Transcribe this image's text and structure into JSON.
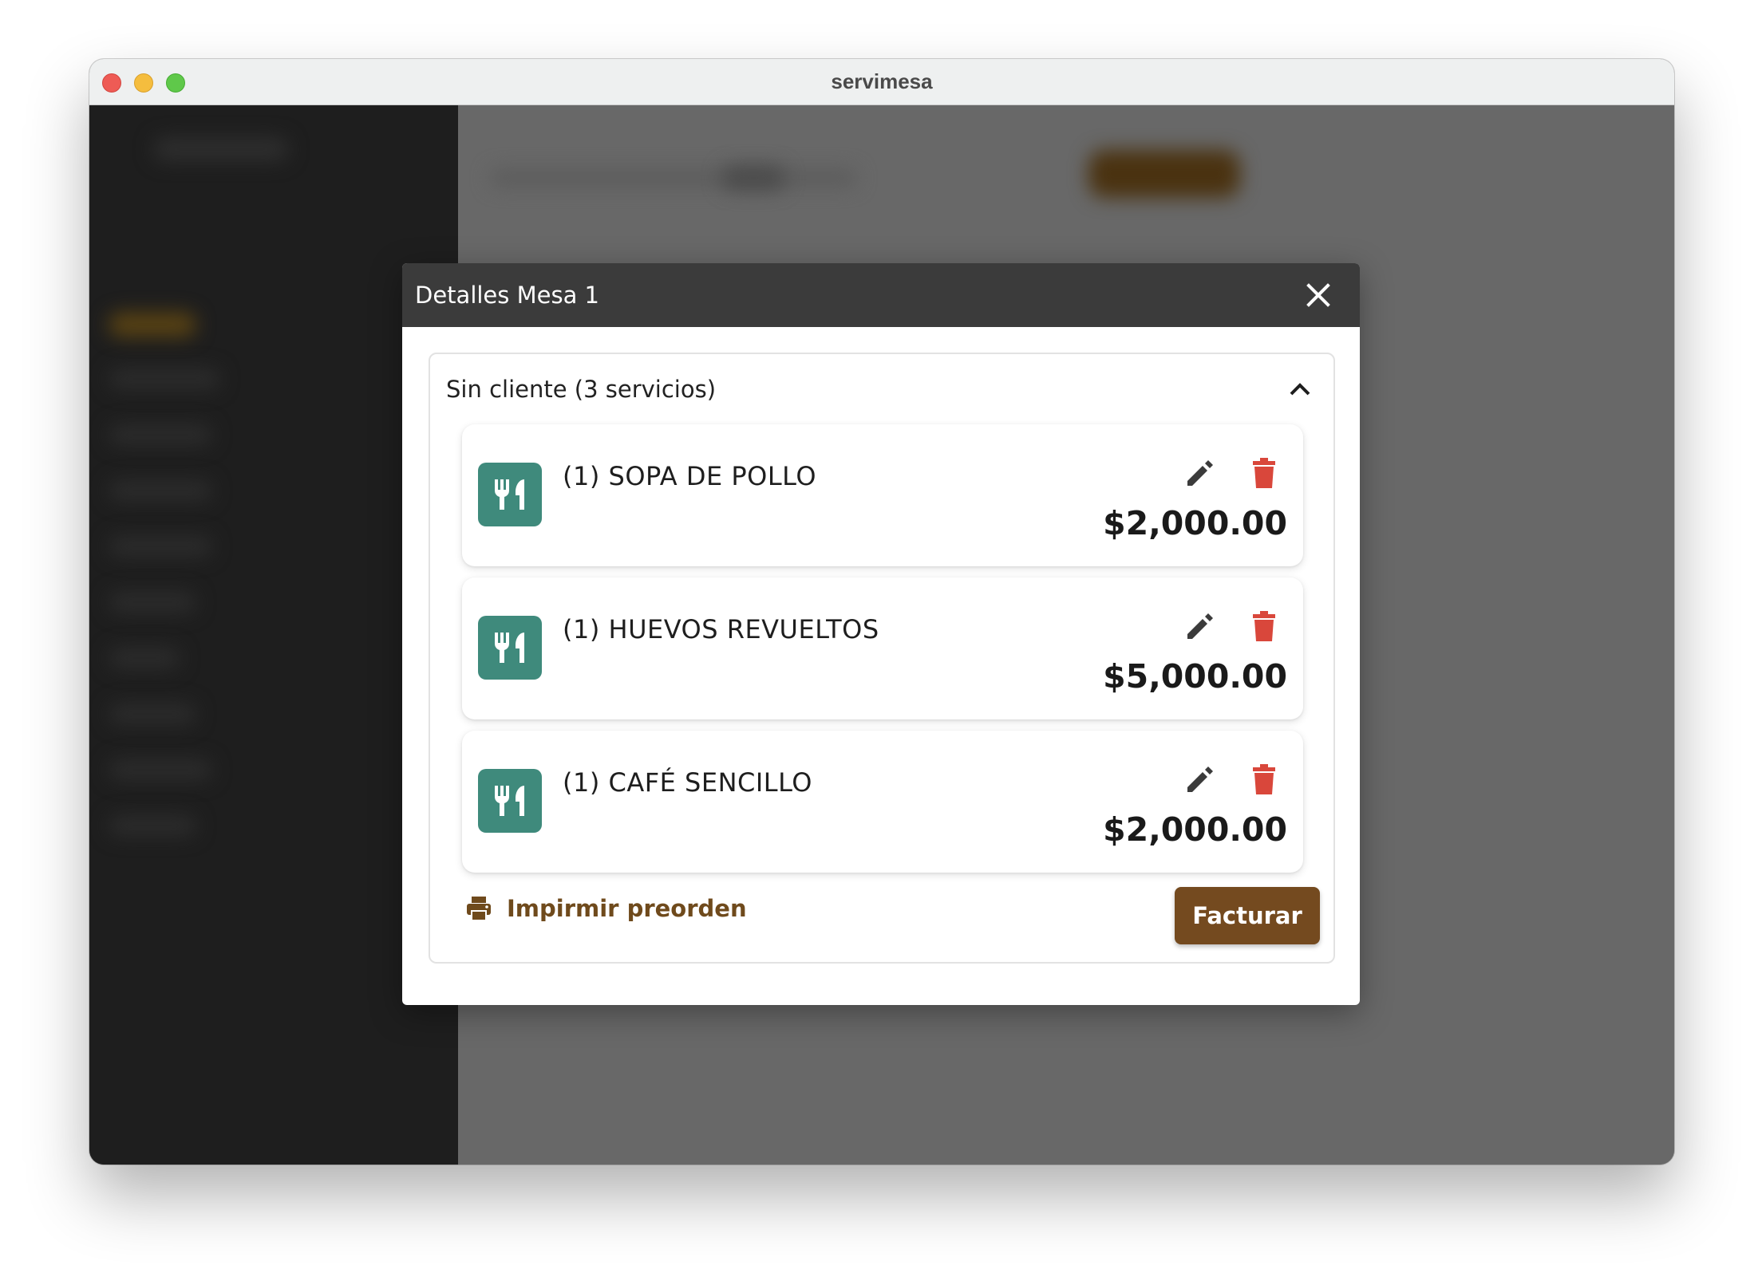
{
  "window": {
    "title": "servimesa"
  },
  "dialog": {
    "title": "Detalles Mesa 1",
    "group": {
      "title": "Sin cliente (3 servicios)",
      "items": [
        {
          "name": "(1) SOPA DE POLLO",
          "price": "$2,000.00"
        },
        {
          "name": "(1) HUEVOS REVUELTOS",
          "price": "$5,000.00"
        },
        {
          "name": "(1) CAFÉ SENCILLO",
          "price": "$2,000.00"
        }
      ],
      "print_label": "Impirmir preorden",
      "invoice_label": "Facturar"
    }
  },
  "colors": {
    "accent_brown": "#744a1f",
    "print_text": "#6f4a1c",
    "thumb_green": "#3f8a7c",
    "delete_red": "#d9473b",
    "header_dark": "#3b3b3b"
  },
  "icons": {
    "item": "utensils-icon",
    "edit": "pencil-icon",
    "delete": "trash-icon",
    "close": "close-icon",
    "collapse": "chevron-up-icon",
    "print": "printer-icon"
  }
}
